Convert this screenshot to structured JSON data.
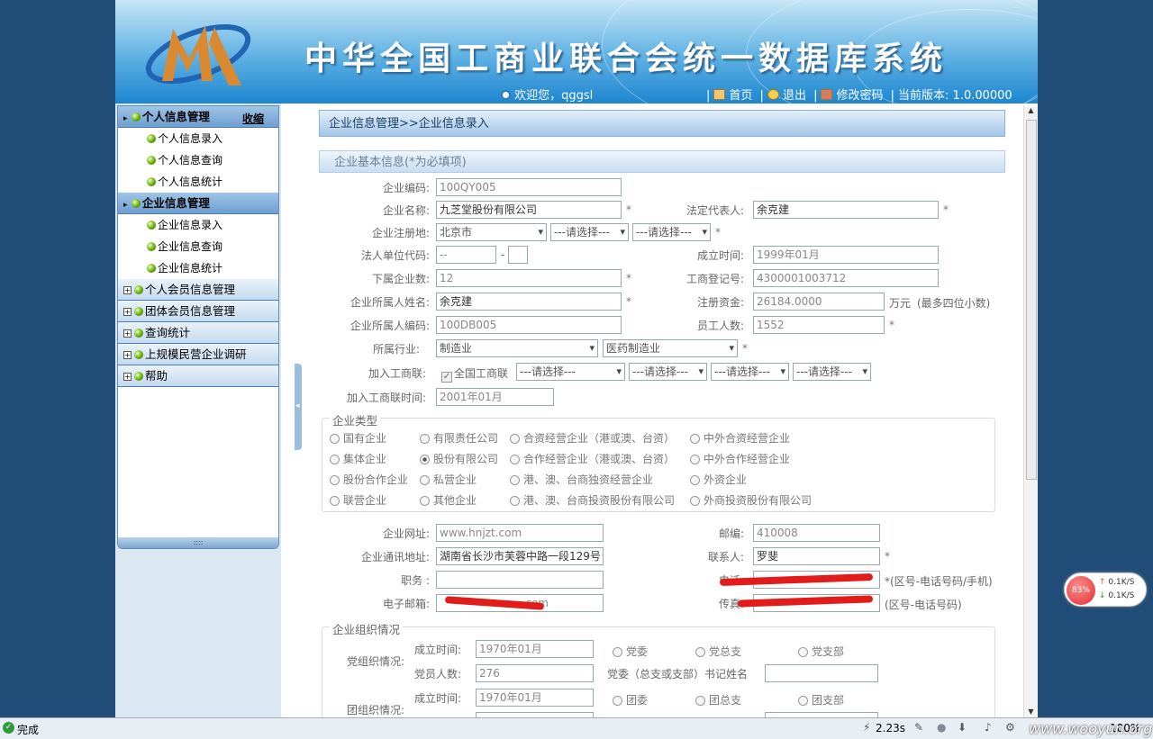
{
  "header": {
    "title": "中华全国工商业联合会统一数据库系统",
    "welcome": "欢迎您，qggsl",
    "nav": [
      {
        "label": "首页",
        "icon": "home-icon"
      },
      {
        "label": "退出",
        "icon": "exit-icon"
      },
      {
        "label": "修改密码",
        "icon": "password-icon"
      }
    ],
    "version": "当前版本: 1.0.00000"
  },
  "sidebar": {
    "collapse": "收缩",
    "groups": [
      {
        "label": "个人信息管理",
        "expanded": true,
        "items": [
          "个人信息录入",
          "个人信息查询",
          "个人信息统计"
        ]
      },
      {
        "label": "企业信息管理",
        "expanded": true,
        "items": [
          "企业信息录入",
          "企业信息查询",
          "企业信息统计"
        ]
      },
      {
        "label": "个人会员信息管理",
        "expanded": false,
        "items": []
      },
      {
        "label": "团体会员信息管理",
        "expanded": false,
        "items": []
      },
      {
        "label": "查询统计",
        "expanded": false,
        "items": []
      },
      {
        "label": "上规模民营企业调研",
        "expanded": false,
        "items": []
      },
      {
        "label": "帮助",
        "expanded": false,
        "items": []
      }
    ],
    "grip": "::::"
  },
  "breadcrumb": "企业信息管理>>企业信息录入",
  "basic": {
    "section_title": "企业基本信息(*为必填项)",
    "code_label": "企业编码:",
    "code_value": "100QY005",
    "name_label": "企业名称:",
    "name_value": "九芝堂股份有限公司",
    "legal_rep_label": "法定代表人:",
    "legal_rep_value": "余克建",
    "region_label": "企业注册地:",
    "region_province": "北京市",
    "region_city": "---请选择---",
    "region_county": "---请选择---",
    "org_code_label": "法人单位代码:",
    "org_code_a": "--",
    "org_code_sep": "-",
    "org_code_b": "",
    "founded_label": "成立时间:",
    "founded_value": "1999年01月",
    "sub_count_label": "下属企业数:",
    "sub_count_value": "12",
    "reg_no_label": "工商登记号:",
    "reg_no_value": "4300001003712",
    "owner_name_label": "企业所属人姓名:",
    "owner_name_value": "余克建",
    "capital_label": "注册资金:",
    "capital_value": "26184.0000",
    "capital_unit": "万元",
    "capital_note": "(最多四位小数)",
    "owner_code_label": "企业所属人编码:",
    "owner_code_value": "100DB005",
    "staff_label": "员工人数:",
    "staff_value": "1552",
    "industry_label": "所属行业:",
    "industry_main": "制造业",
    "industry_sub": "医药制造业",
    "union_label": "加入工商联:",
    "union_check": "全国工商联",
    "union_selects": [
      "---请选择---",
      "---请选择---",
      "---请选择---",
      "---请选择---"
    ],
    "union_time_label": "加入工商联时间:",
    "union_time_value": "2001年01月",
    "required": "*"
  },
  "enterprise_type": {
    "legend": "企业类型",
    "options": [
      [
        "国有企业",
        "有限责任公司",
        "合资经营企业（港或澳、台资）",
        "中外合资经营企业"
      ],
      [
        "集体企业",
        "股份有限公司",
        "合作经营企业（港或澳、台资）",
        "中外合作经营企业"
      ],
      [
        "股份合作企业",
        "私营企业",
        "港、澳、台商独资经营企业",
        "外资企业"
      ],
      [
        "联营企业",
        "其他企业",
        "港、澳、台商投资股份有限公司",
        "外商投资股份有限公司"
      ]
    ],
    "selected": "股份有限公司"
  },
  "contact": {
    "website_label": "企业网址:",
    "website_value": "www.hnjzt.com",
    "postcode_label": "邮编:",
    "postcode_value": "410008",
    "address_label": "企业通讯地址:",
    "address_value": "湖南省长沙市芙蓉中路一段129号",
    "contact_label": "联系人:",
    "contact_value": "罗斐",
    "position_label": "职务 :",
    "position_value": "",
    "phone_label": "电话:",
    "phone_note": "*(区号-电话号码/手机)",
    "email_label": "电子邮箱:",
    "email_value": ".com",
    "fax_label": "传真:",
    "fax_note": "(区号-电话号码)"
  },
  "org": {
    "legend": "企业组织情况",
    "party_label": "党组织情况:",
    "party_founded_label": "成立时间:",
    "party_founded_value": "1970年01月",
    "party_options": [
      "党委",
      "党总支",
      "党支部"
    ],
    "party_members_label": "党员人数:",
    "party_members_value": "276",
    "party_secretary_label": "党委（总支或支部）书记姓名",
    "youth_label": "团组织情况:",
    "youth_founded_label": "成立时间:",
    "youth_founded_value": "1970年01月",
    "youth_options": [
      "团委",
      "团总支",
      "团支部"
    ]
  },
  "statusbar": {
    "done": "完成",
    "time": "2.23s",
    "zoom": "100%"
  },
  "speed_widget": {
    "percent": "83%",
    "up": "0.1K/S",
    "down": "0.1K/S"
  },
  "watermark": "www.wooyun.org"
}
